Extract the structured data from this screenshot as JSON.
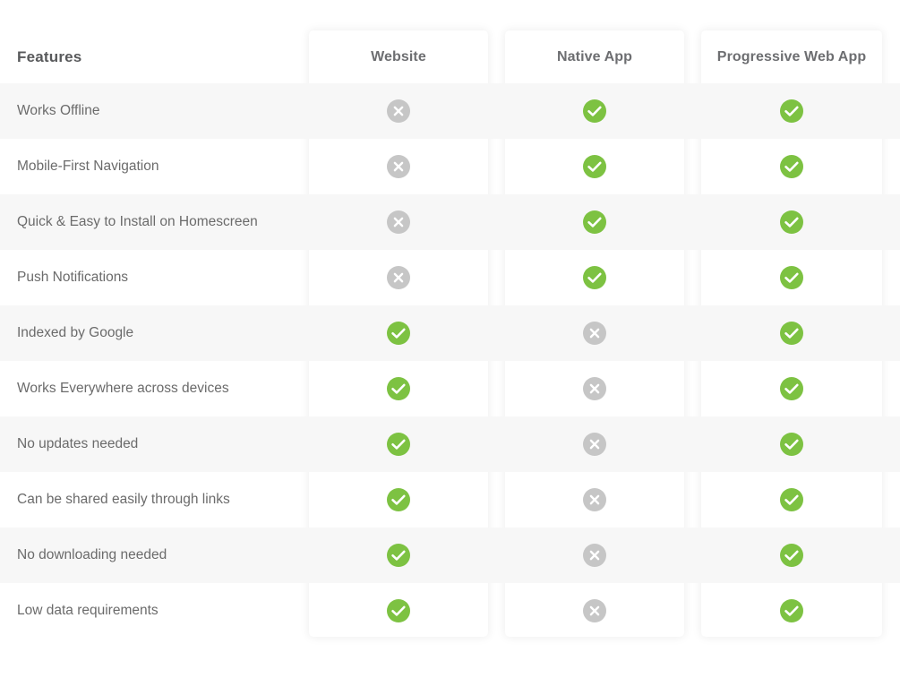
{
  "table": {
    "features_header": "Features",
    "columns": [
      {
        "label": "Website"
      },
      {
        "label": "Native App"
      },
      {
        "label": "Progressive Web App"
      }
    ],
    "colors": {
      "yes": "#7dc242",
      "no": "#c6c6c6",
      "stripe": "#f6f6f6",
      "header_text": "#6d6e71",
      "label_text": "#6b6b6b"
    },
    "icons": {
      "yes": "check-circle-icon",
      "no": "cross-circle-icon"
    },
    "rows": [
      {
        "feature": "Works Offline",
        "values": [
          "no",
          "yes",
          "yes"
        ]
      },
      {
        "feature": "Mobile-First Navigation",
        "values": [
          "no",
          "yes",
          "yes"
        ]
      },
      {
        "feature": "Quick & Easy to Install on Homescreen",
        "values": [
          "no",
          "yes",
          "yes"
        ]
      },
      {
        "feature": "Push Notifications",
        "values": [
          "no",
          "yes",
          "yes"
        ]
      },
      {
        "feature": "Indexed by Google",
        "values": [
          "yes",
          "no",
          "yes"
        ]
      },
      {
        "feature": "Works Everywhere across devices",
        "values": [
          "yes",
          "no",
          "yes"
        ]
      },
      {
        "feature": "No updates needed",
        "values": [
          "yes",
          "no",
          "yes"
        ]
      },
      {
        "feature": "Can be shared easily through links",
        "values": [
          "yes",
          "no",
          "yes"
        ]
      },
      {
        "feature": "No downloading needed",
        "values": [
          "yes",
          "no",
          "yes"
        ]
      },
      {
        "feature": "Low data requirements",
        "values": [
          "yes",
          "no",
          "yes"
        ]
      }
    ]
  }
}
